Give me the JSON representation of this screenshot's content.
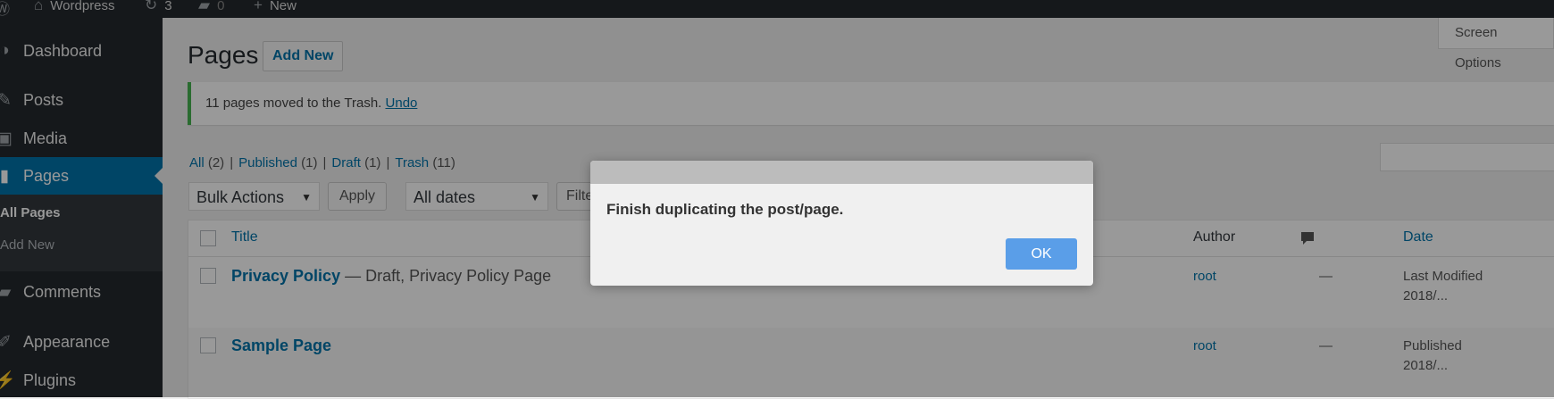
{
  "adminbar": {
    "site_name": "Wordpress",
    "updates_count": "3",
    "comments_count": "0",
    "new_label": "New"
  },
  "sidebar": {
    "items": [
      {
        "label": "Dashboard",
        "icon": "dashboard-icon"
      },
      {
        "label": "Posts",
        "icon": "pin-icon"
      },
      {
        "label": "Media",
        "icon": "media-icon"
      },
      {
        "label": "Pages",
        "icon": "page-icon"
      },
      {
        "label": "Comments",
        "icon": "comment-icon"
      },
      {
        "label": "Appearance",
        "icon": "brush-icon"
      },
      {
        "label": "Plugins",
        "icon": "plugin-icon"
      }
    ],
    "submenu": [
      "All Pages",
      "Add New"
    ]
  },
  "main": {
    "title": "Pages",
    "add_new": "Add New",
    "screen_options": "Screen Options",
    "notice": {
      "text": "11 pages moved to the Trash.",
      "undo": "Undo"
    },
    "filters": [
      {
        "label": "All",
        "count": "(2)"
      },
      {
        "label": "Published",
        "count": "(1)"
      },
      {
        "label": "Draft",
        "count": "(1)"
      },
      {
        "label": "Trash",
        "count": "(11)"
      }
    ],
    "bulk_actions": "Bulk Actions",
    "apply": "Apply",
    "all_dates": "All dates",
    "filter": "Filter",
    "table": {
      "headers": {
        "title": "Title",
        "author": "Author",
        "date": "Date"
      },
      "rows": [
        {
          "title": "Privacy Policy",
          "state": " — Draft, Privacy Policy Page",
          "author": "root",
          "comments": "—",
          "date_line1": "Last Modified",
          "date_line2": "2018/..."
        },
        {
          "title": "Sample Page",
          "state": "",
          "author": "root",
          "comments": "—",
          "date_line1": "Published",
          "date_line2": "2018/..."
        }
      ]
    }
  },
  "dialog": {
    "message": "Finish duplicating the post/page.",
    "ok": "OK"
  },
  "colors": {
    "accent": "#0073aa",
    "admin_dark": "#23282d",
    "notice_success": "#46b450",
    "ok_button": "#5a9ee8"
  }
}
